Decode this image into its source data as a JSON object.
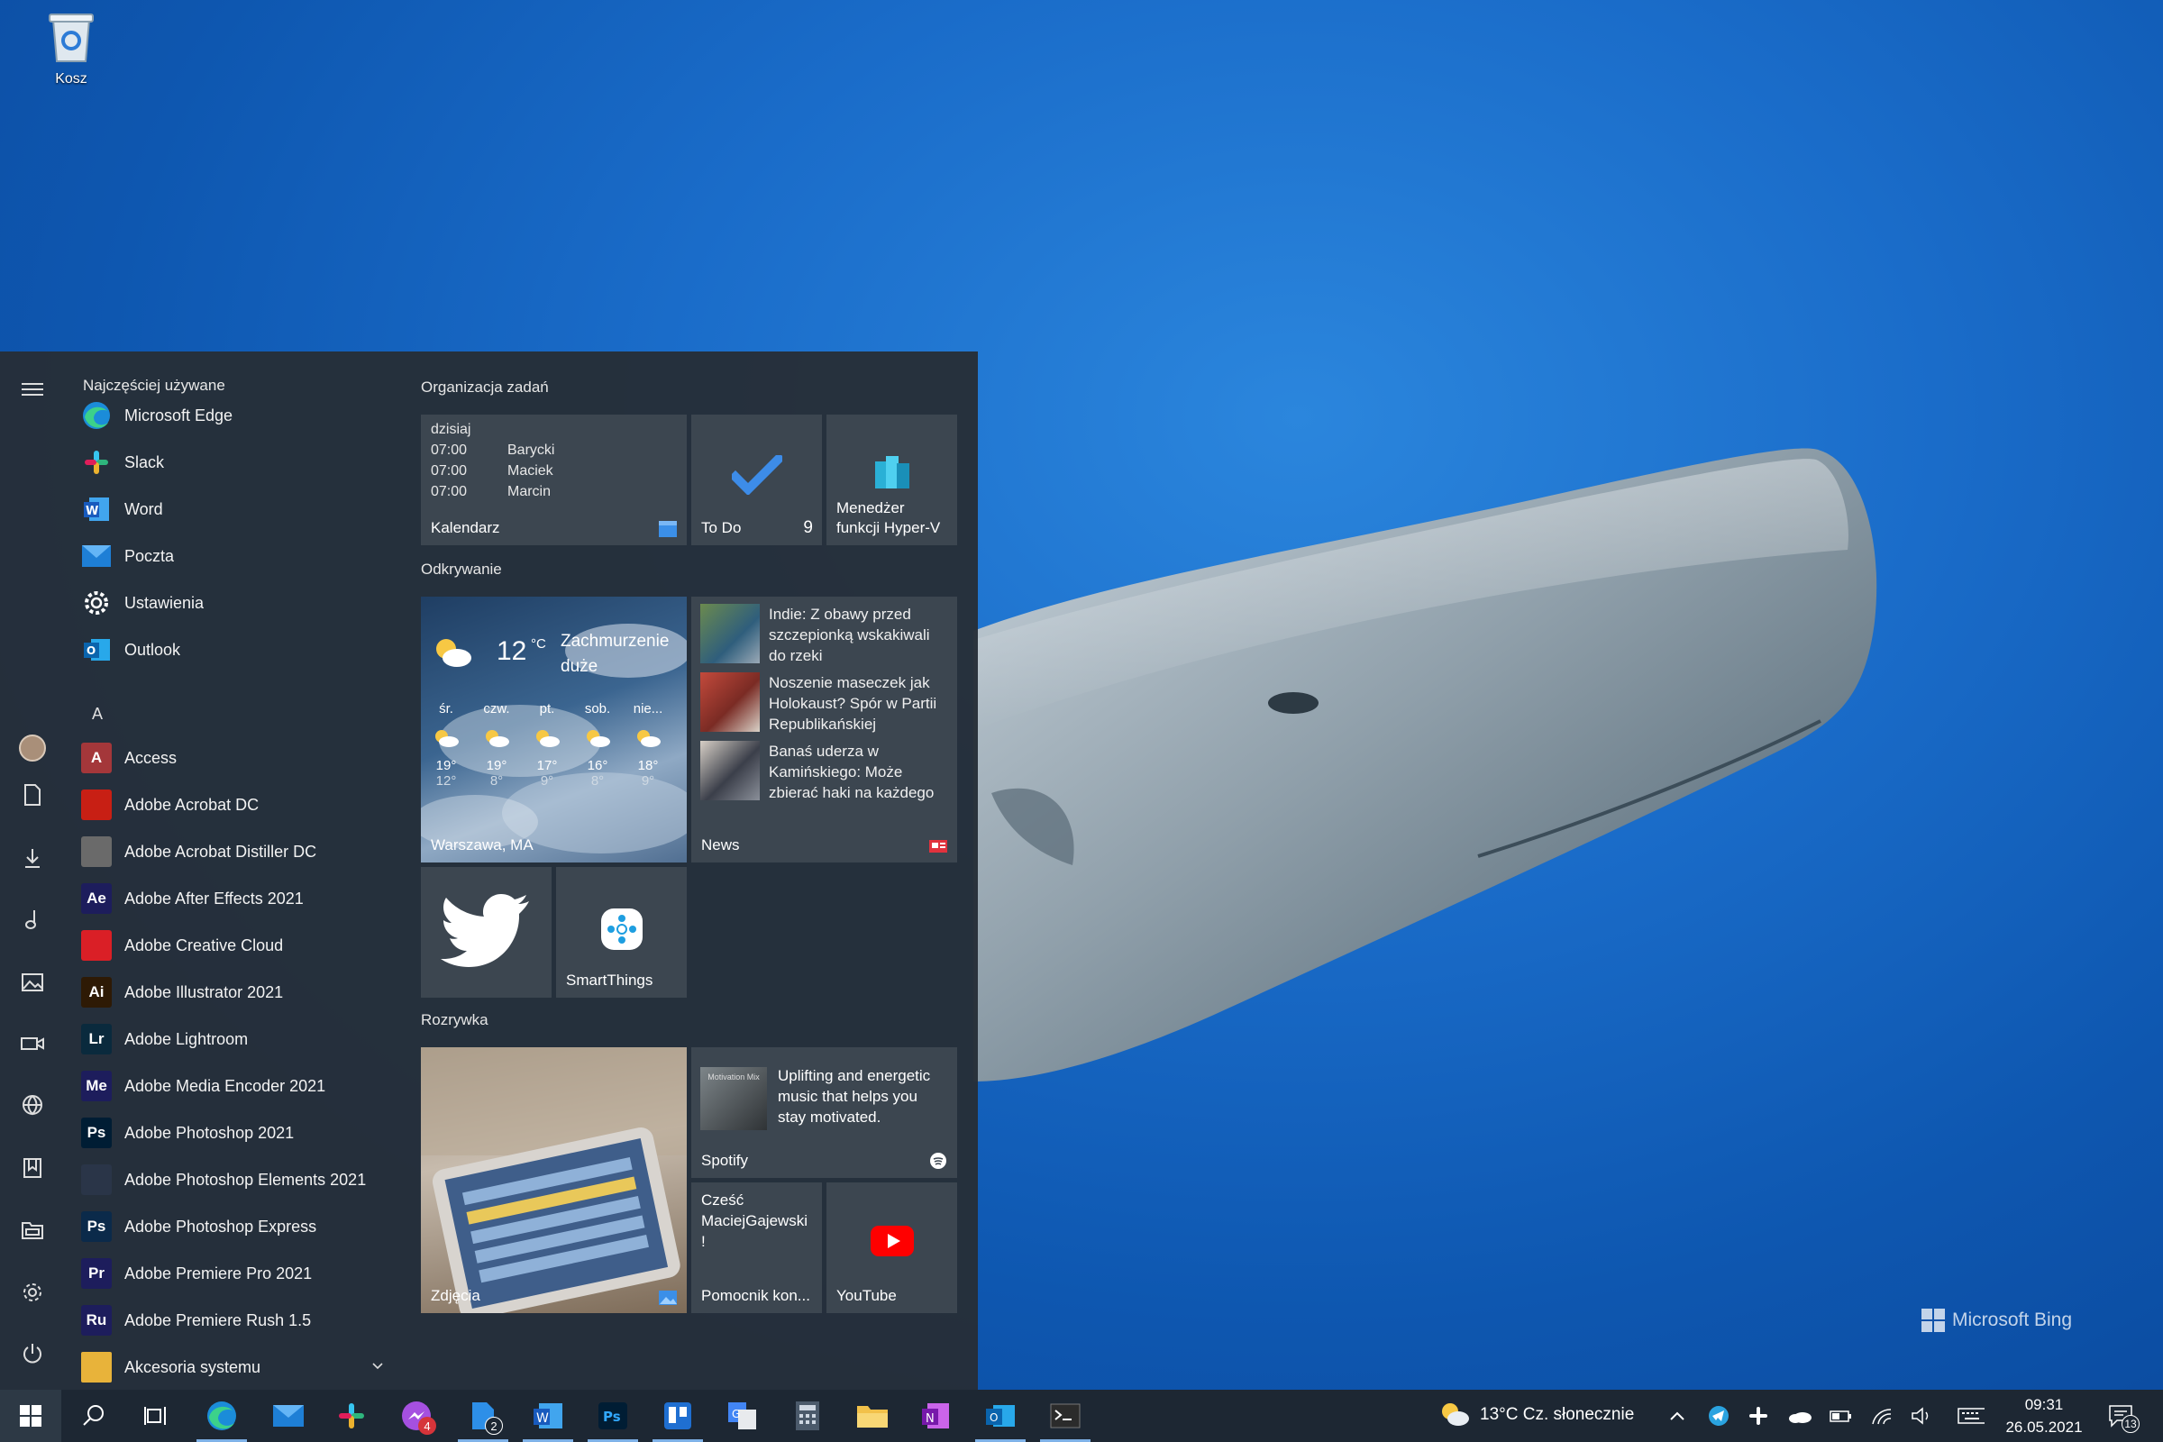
{
  "desktop": {
    "recycle_bin_label": "Kosz",
    "wallpaper_brand": "Microsoft Bing"
  },
  "start_menu": {
    "most_used_header": "Najczęściej używane",
    "most_used": [
      {
        "label": "Microsoft Edge",
        "icon": "edge-icon"
      },
      {
        "label": "Slack",
        "icon": "slack-icon"
      },
      {
        "label": "Word",
        "icon": "word-icon"
      },
      {
        "label": "Poczta",
        "icon": "mail-icon"
      },
      {
        "label": "Ustawienia",
        "icon": "gear-icon"
      },
      {
        "label": "Outlook",
        "icon": "outlook-icon"
      }
    ],
    "letter_a": "A",
    "apps": [
      {
        "label": "Access",
        "icon_text": "A",
        "color": "#a4373a"
      },
      {
        "label": "Adobe Acrobat DC",
        "icon_text": "",
        "color": "#c81f14"
      },
      {
        "label": "Adobe Acrobat Distiller DC",
        "icon_text": "",
        "color": "#6a6a6a"
      },
      {
        "label": "Adobe After Effects 2021",
        "icon_text": "Ae",
        "color": "#1d1d5c"
      },
      {
        "label": "Adobe Creative Cloud",
        "icon_text": "",
        "color": "#da1f26"
      },
      {
        "label": "Adobe Illustrator 2021",
        "icon_text": "Ai",
        "color": "#2e1a05"
      },
      {
        "label": "Adobe Lightroom",
        "icon_text": "Lr",
        "color": "#0a2a3d"
      },
      {
        "label": "Adobe Media Encoder 2021",
        "icon_text": "Me",
        "color": "#1d1d5c"
      },
      {
        "label": "Adobe Photoshop 2021",
        "icon_text": "Ps",
        "color": "#001d34"
      },
      {
        "label": "Adobe Photoshop Elements 2021",
        "icon_text": "",
        "color": "#2a3548"
      },
      {
        "label": "Adobe Photoshop Express",
        "icon_text": "Ps",
        "color": "#0b2a4a"
      },
      {
        "label": "Adobe Premiere Pro 2021",
        "icon_text": "Pr",
        "color": "#1d1d5c"
      },
      {
        "label": "Adobe Premiere Rush 1.5",
        "icon_text": "Ru",
        "color": "#1d1d5c"
      },
      {
        "label": "Akcesoria systemu",
        "icon_text": "",
        "color": "#e8b33a"
      }
    ],
    "groups": {
      "tasks": "Organizacja zadań",
      "discover": "Odkrywanie",
      "fun": "Rozrywka"
    },
    "tiles": {
      "calendar": {
        "label": "Kalendarz",
        "today": "dzisiaj",
        "events": [
          {
            "time": "07:00",
            "name": "Barycki"
          },
          {
            "time": "07:00",
            "name": "Maciek"
          },
          {
            "time": "07:00",
            "name": "Marcin"
          }
        ]
      },
      "todo": {
        "label": "To Do",
        "count": "9"
      },
      "hyperv": {
        "label_1": "Menedżer",
        "label_2": "funkcji Hyper-V"
      },
      "weather": {
        "temp": "12",
        "unit": "°C",
        "desc_1": "Zachmurzenie",
        "desc_2": "duże",
        "location": "Warszawa, MA",
        "days": [
          {
            "day": "śr.",
            "high": "19°",
            "low": "12°"
          },
          {
            "day": "czw.",
            "high": "19°",
            "low": "8°"
          },
          {
            "day": "pt.",
            "high": "17°",
            "low": "9°"
          },
          {
            "day": "sob.",
            "high": "16°",
            "low": "8°"
          },
          {
            "day": "nie...",
            "high": "18°",
            "low": "9°"
          }
        ]
      },
      "news": {
        "label": "News",
        "items": [
          {
            "l1": "Indie: Z obawy przed",
            "l2": "szczepionką wskakiwali",
            "l3": "do rzeki"
          },
          {
            "l1": "Noszenie maseczek jak",
            "l2": "Holokaust? Spór w Partii",
            "l3": "Republikańskiej"
          },
          {
            "l1": "Banaś uderza w",
            "l2": "Kamińskiego: Może",
            "l3": "zbierać haki na każdego"
          }
        ]
      },
      "smartthings": {
        "label": "SmartThings"
      },
      "photos": {
        "label": "Zdjęcia"
      },
      "spotify": {
        "label": "Spotify",
        "l1": "Uplifting and energetic",
        "l2": "music that helps you",
        "l3": "stay motivated.",
        "thumb_text": "Motivation Mix"
      },
      "cortana": {
        "l1": "Cześć",
        "l2": "MaciejGajewski",
        "l3": "!",
        "label": "Pomocnik kon..."
      },
      "youtube": {
        "label": "YouTube"
      }
    }
  },
  "taskbar": {
    "weather_text": "13°C  Cz. słonecznie",
    "time": "09:31",
    "date": "26.05.2021",
    "notification_count": "13",
    "badges": {
      "messenger": "4",
      "files": "2"
    }
  }
}
